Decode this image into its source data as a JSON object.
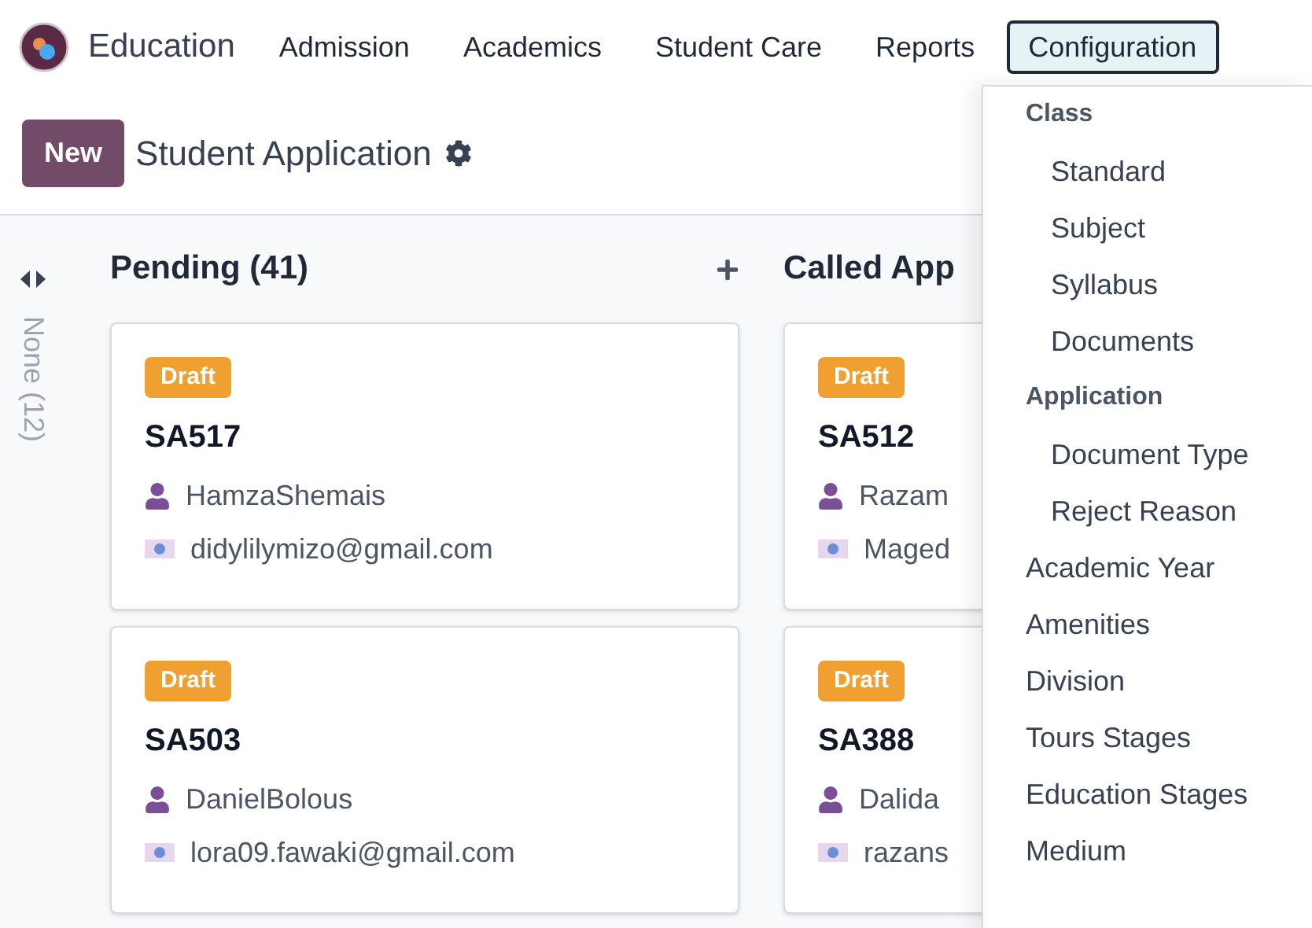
{
  "app": {
    "name": "Education"
  },
  "nav": [
    {
      "label": "Admission",
      "selected": false
    },
    {
      "label": "Academics",
      "selected": false
    },
    {
      "label": "Student Care",
      "selected": false
    },
    {
      "label": "Reports",
      "selected": false
    },
    {
      "label": "Configuration",
      "selected": true
    }
  ],
  "control_panel": {
    "new_button": "New",
    "title": "Student Application"
  },
  "folded_column": {
    "label": "None (12)"
  },
  "columns": [
    {
      "title": "Pending (41)",
      "cards": [
        {
          "status": "Draft",
          "ref": "SA517",
          "name": "HamzaShemais",
          "email": "didylilymizo@gmail.com"
        },
        {
          "status": "Draft",
          "ref": "SA503",
          "name": "DanielBolous",
          "email": "lora09.fawaki@gmail.com"
        }
      ]
    },
    {
      "title": "Called App",
      "cards": [
        {
          "status": "Draft",
          "ref": "SA512",
          "name": "Razam",
          "email": "Maged"
        },
        {
          "status": "Draft",
          "ref": "SA388",
          "name": "Dalida",
          "email": "razans"
        }
      ]
    }
  ],
  "menu": [
    {
      "kind": "header",
      "label": "Class"
    },
    {
      "kind": "subitem",
      "label": "Standard"
    },
    {
      "kind": "subitem",
      "label": "Subject"
    },
    {
      "kind": "subitem",
      "label": "Syllabus"
    },
    {
      "kind": "subitem",
      "label": "Documents"
    },
    {
      "kind": "header",
      "label": "Application"
    },
    {
      "kind": "subitem",
      "label": "Document Type"
    },
    {
      "kind": "subitem",
      "label": "Reject Reason"
    },
    {
      "kind": "item",
      "label": "Academic Year"
    },
    {
      "kind": "item",
      "label": "Amenities"
    },
    {
      "kind": "item",
      "label": "Division"
    },
    {
      "kind": "item",
      "label": "Tours Stages"
    },
    {
      "kind": "item",
      "label": "Education Stages"
    },
    {
      "kind": "item",
      "label": "Medium"
    }
  ]
}
